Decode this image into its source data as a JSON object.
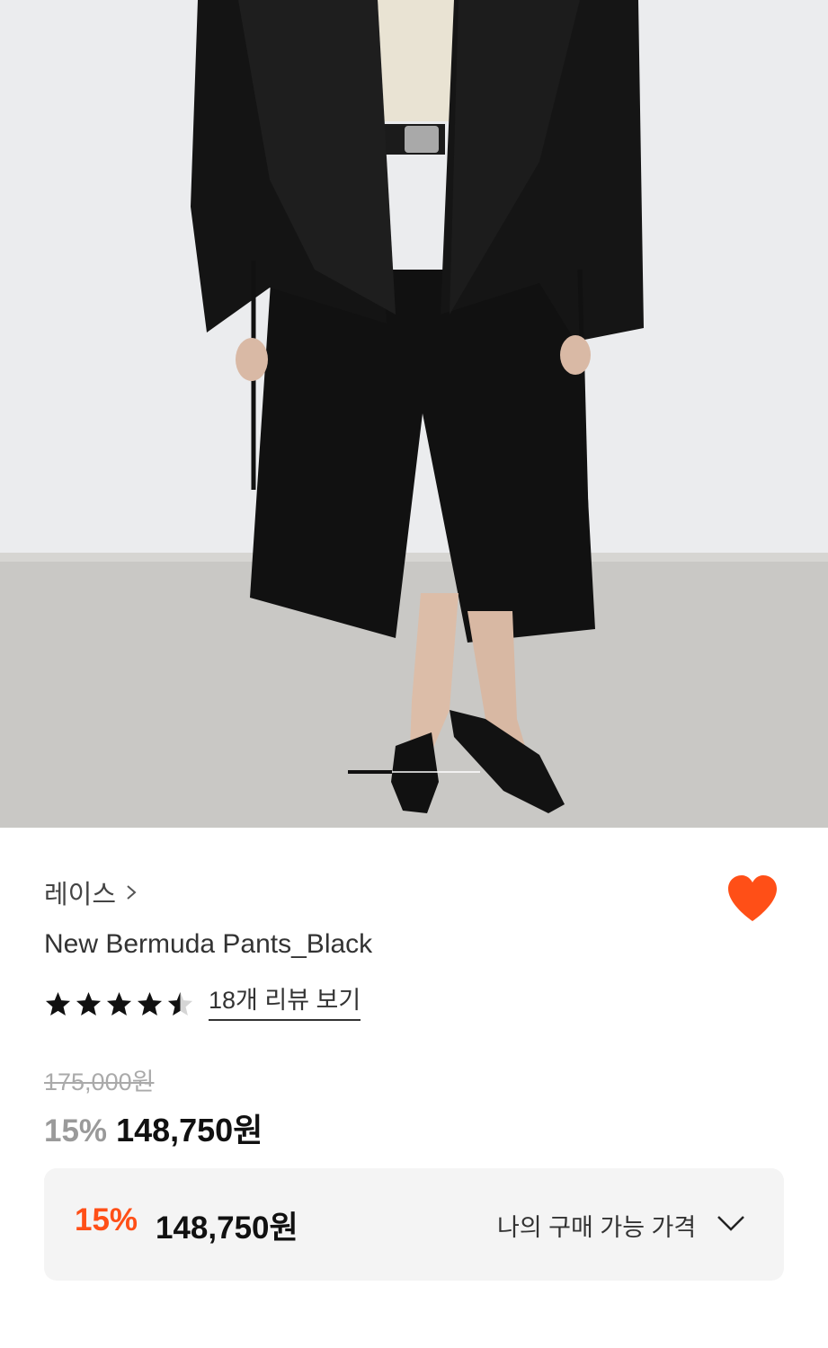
{
  "gallery": {
    "image_alt": "model wearing black jacket and black bermuda pants with black sandals",
    "slide_index": 1,
    "slide_count": 3
  },
  "product": {
    "brand": "레이스",
    "name": "New Bermuda Pants_Black",
    "rating": 4.5,
    "review_link": "18개 리뷰 보기",
    "original_price": "175,000원",
    "discount_percent": "15%",
    "sale_price": "148,750원",
    "favorited": true
  },
  "my_price": {
    "discount_percent": "15%",
    "price": "148,750원",
    "label": "나의 구매 가능 가격"
  },
  "colors": {
    "accent": "#ff4f17",
    "heart": "#ff4f17",
    "text_primary": "#111111",
    "text_muted": "#aaaaaa"
  },
  "icons": {
    "brand_chevron": "chevron-right-icon",
    "favorite": "heart-icon",
    "rating": "star-icon",
    "expand": "chevron-down-icon"
  }
}
